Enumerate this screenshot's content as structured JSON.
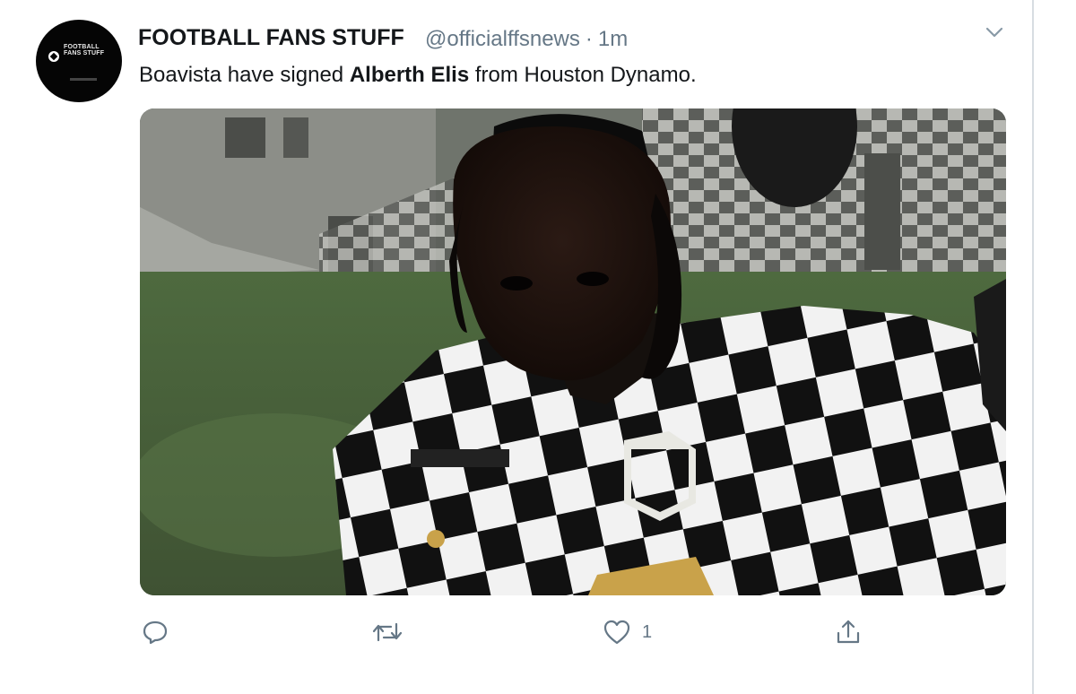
{
  "tweet": {
    "display_name": "FOOTBALL FANS STUFF",
    "handle": "@officialffsnews",
    "separator": "·",
    "timestamp": "1m",
    "text_before": "Boavista have signed ",
    "text_bold": "Alberth Elis",
    "text_after": " from Houston Dynamo.",
    "avatar_logo_text": "FOOTBALL FANS STUFF"
  },
  "actions": {
    "reply_icon": "reply-icon",
    "retweet_icon": "retweet-icon",
    "like_icon": "heart-icon",
    "like_count": "1",
    "share_icon": "share-icon"
  },
  "colors": {
    "text_primary": "#14171a",
    "text_secondary": "#657786",
    "border": "#d7dde2"
  }
}
